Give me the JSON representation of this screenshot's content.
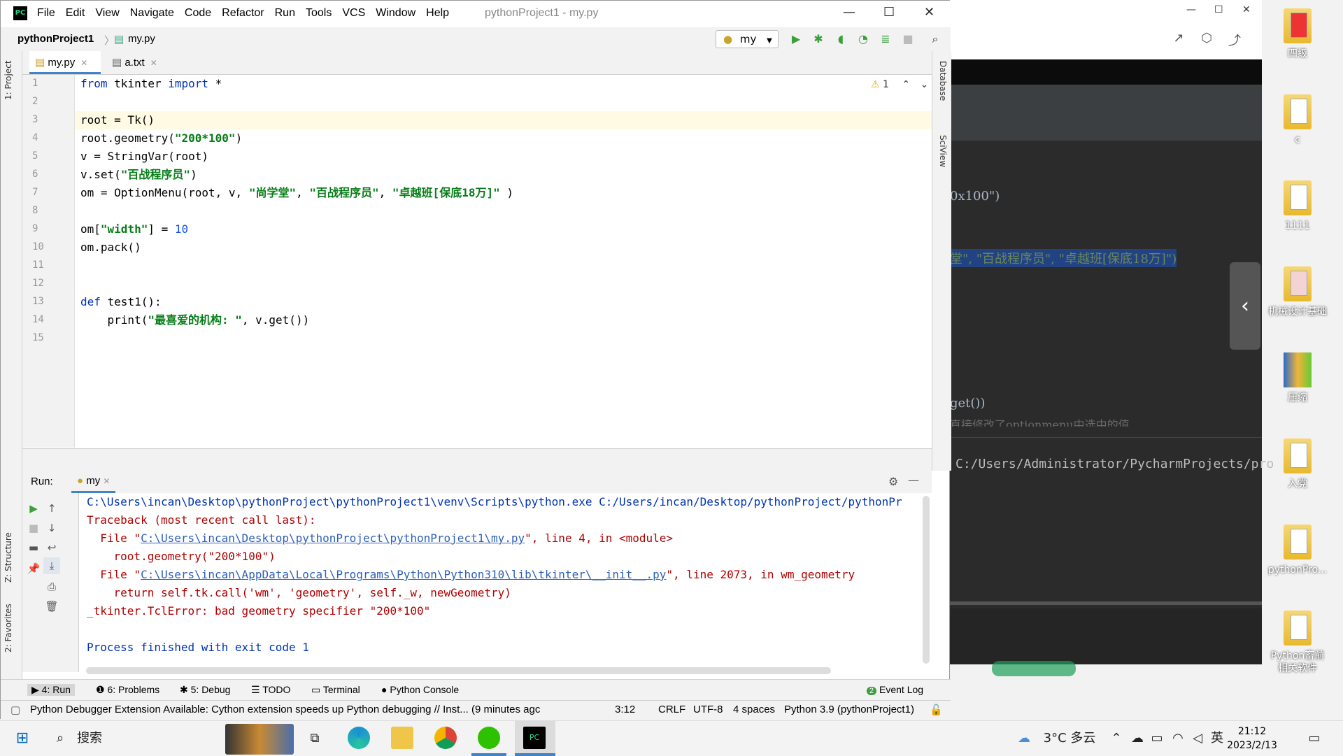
{
  "ide": {
    "menu": [
      "File",
      "Edit",
      "View",
      "Navigate",
      "Code",
      "Refactor",
      "Run",
      "Tools",
      "VCS",
      "Window",
      "Help"
    ],
    "title": "pythonProject1 - my.py",
    "breadcrumb": {
      "project": "pythonProject1",
      "file": "my.py"
    },
    "run_config": "my",
    "left_tabs": {
      "project": "1: Project",
      "structure": "Z: Structure",
      "favorites": "2: Favorites"
    },
    "right_tabs": {
      "database": "Database",
      "sciview": "SciView"
    },
    "tabs": [
      {
        "label": "my.py"
      },
      {
        "label": "a.txt"
      }
    ],
    "warning_count": "1",
    "line_numbers": [
      "1",
      "2",
      "3",
      "4",
      "5",
      "6",
      "7",
      "8",
      "9",
      "10",
      "11",
      "12",
      "13",
      "14",
      "15"
    ],
    "code": {
      "l1a": "from",
      " l1b": "",
      "l1": "from tkinter import *",
      "l3": "root = Tk()",
      "l4a": "root.geometry(",
      "l4s": "\"200*100\"",
      "l4b": ")",
      "l5": "v = StringVar(root)",
      "l6a": "v.set(",
      "l6s": "\"百战程序员\"",
      "l6b": ")",
      "l7a": "om = OptionMenu(root, v, ",
      "l7s1": "\"尚学堂\"",
      "l7c1": ", ",
      "l7s2": "\"百战程序员\"",
      "l7c2": ", ",
      "l7s3": "\"卓越班[保底18万]\"",
      "l7b": " )",
      "l9a": "om[",
      "l9s": "\"width\"",
      "l9b": "] = ",
      "l9n": "10",
      "l10": "om.pack()",
      "l13kw": "def",
      "l13": " test1():",
      "l14a": "    print(",
      "l14s": "\"最喜爱的机构: \"",
      "l14b": ", v.get())"
    },
    "run": {
      "label": "Run:",
      "tab": "my",
      "console": [
        "C:\\Users\\incan\\Desktop\\pythonProject\\pythonProject1\\venv\\Scripts\\python.exe C:/Users/incan/Desktop/pythonProject/pythonPr",
        "Traceback (most recent call last):",
        "  File \"",
        "C:\\Users\\incan\\Desktop\\pythonProject\\pythonProject1\\my.py",
        "\", line 4, in <module>",
        "    root.geometry(\"200*100\")",
        "  File \"",
        "C:\\Users\\incan\\AppData\\Local\\Programs\\Python\\Python310\\lib\\tkinter\\__init__.py",
        "\", line 2073, in wm_geometry",
        "    return self.tk.call('wm', 'geometry', self._w, newGeometry)",
        "_tkinter.TclError: bad geometry specifier \"200*100\"",
        "Process finished with exit code 1"
      ]
    },
    "toolwindows": [
      "4: Run",
      "6: Problems",
      "5: Debug",
      "TODO",
      "Terminal",
      "Python Console",
      "Event Log"
    ],
    "event_log_count": "2",
    "status": {
      "message": "Python Debugger Extension Available: Cython extension speeds up Python debugging // Inst... (9 minutes agc",
      "position": "3:12",
      "line_sep": "CRLF",
      "encoding": "UTF-8",
      "indent": "4 spaces",
      "interpreter": "Python 3.9 (pythonProject1)"
    }
  },
  "background_window": {
    "code1": "0x100\")",
    "code2": "堂\", \"百战程序员\", \"卓越班[保底18万]\")",
    "code3": "get())",
    "code4": "直接修改了optionmenu中选中的值",
    "path": "C:/Users/Administrator/PycharmProjects/pro"
  },
  "desktop_icons": [
    "四级",
    "c",
    "1111",
    "机械设计基础",
    "压缩",
    "入党",
    "pythonPro...",
    "Python畜前\n相关软件"
  ],
  "taskbar": {
    "search": "搜索",
    "weather": "3°C 多云",
    "ime": "英",
    "time": "21:12",
    "date": "2023/2/13"
  }
}
